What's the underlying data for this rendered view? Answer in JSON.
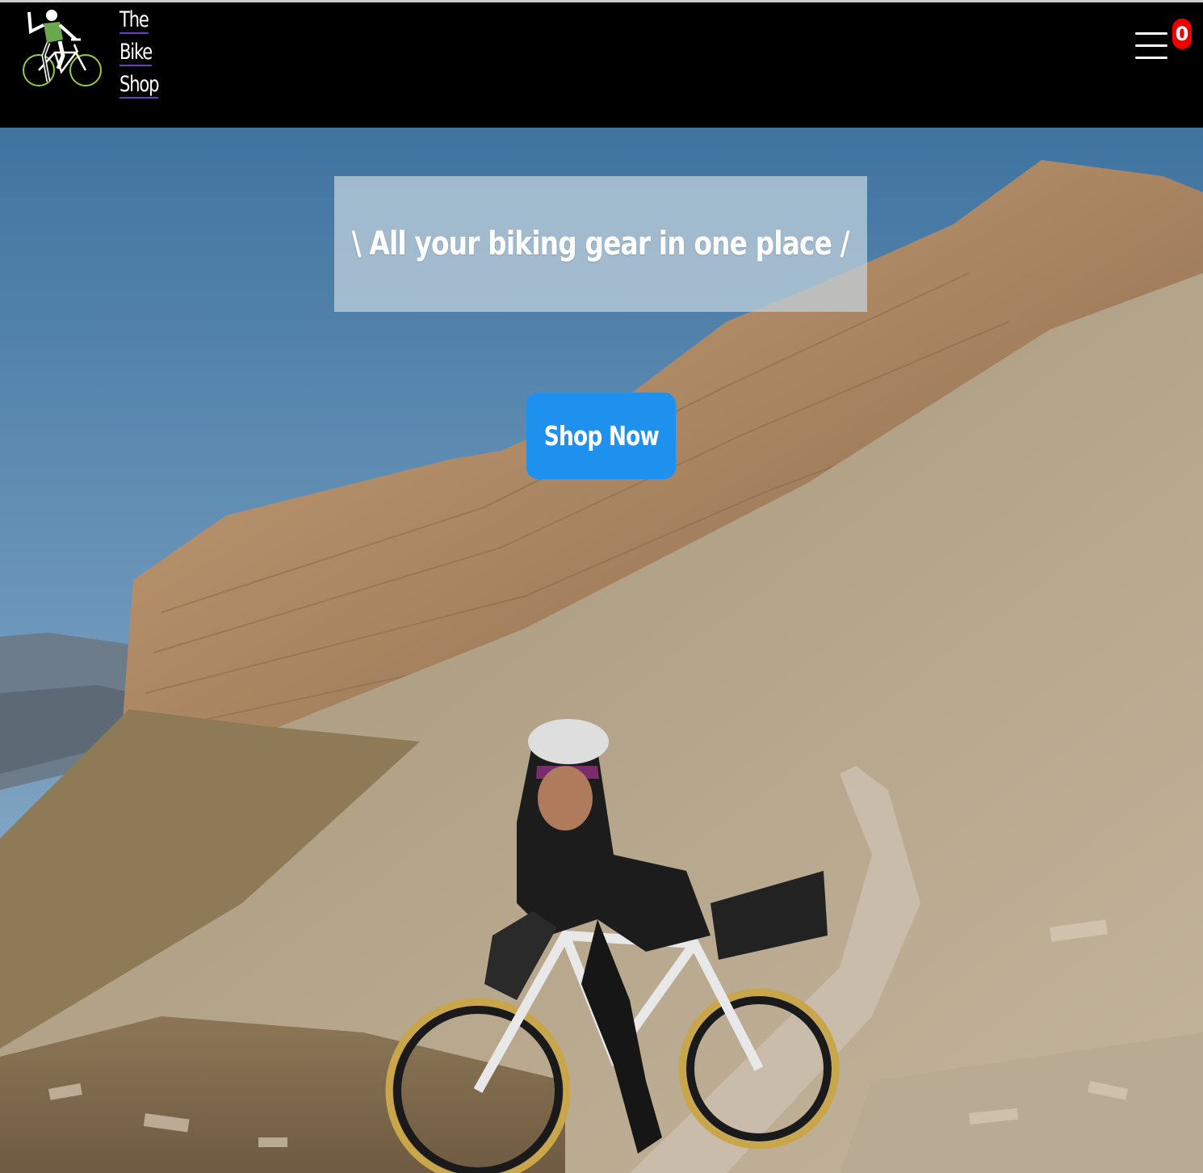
{
  "brand": {
    "line1": "The",
    "line2": "Bike",
    "line3": "Shop"
  },
  "header": {
    "menu_icon": "hamburger-menu-icon",
    "cart_count": "0"
  },
  "hero": {
    "tagline": "\\ All your biking gear in one place /",
    "cta_label": "Shop Now",
    "background": "photo of cyclist on gravel road below cliffs"
  },
  "colors": {
    "header_bg": "#000000",
    "cta": "#1e90ee",
    "badge": "#ee0000",
    "brand_underline": "#6a3fc6"
  }
}
